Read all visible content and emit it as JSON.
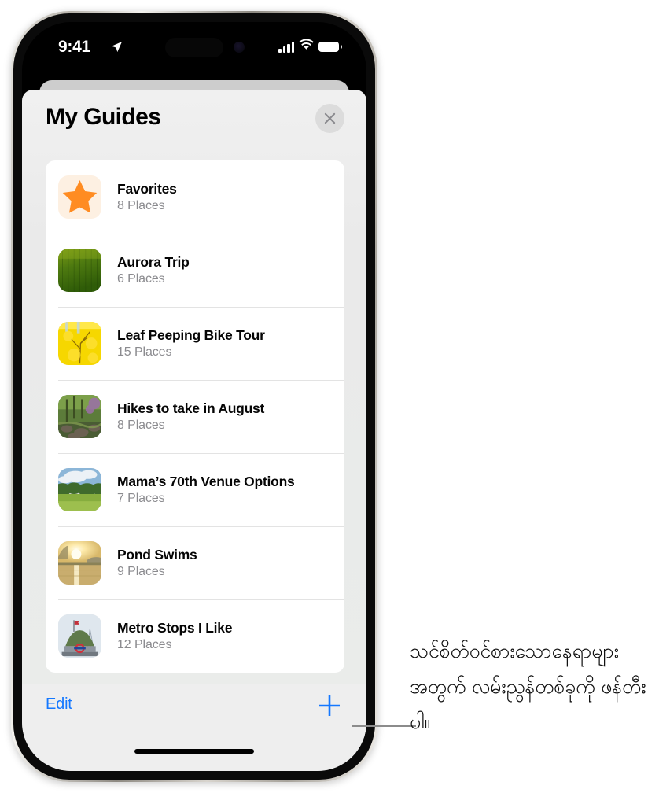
{
  "status_bar": {
    "time": "9:41",
    "location_icon": "location-arrow-icon",
    "signal_icon": "cellular-signal-icon",
    "wifi_icon": "wifi-icon",
    "battery_icon": "battery-full-icon"
  },
  "sheet": {
    "title": "My Guides",
    "close_icon": "close-x-icon"
  },
  "guides": [
    {
      "title": "Favorites",
      "places": "8 Places",
      "thumb": "star-icon"
    },
    {
      "title": "Aurora Trip",
      "places": "6 Places",
      "thumb": "green-field-photo"
    },
    {
      "title": "Leaf Peeping Bike Tour",
      "places": "15 Places",
      "thumb": "yellow-autumn-tree-photo"
    },
    {
      "title": "Hikes to take in August",
      "places": "8 Places",
      "thumb": "forest-trail-photo"
    },
    {
      "title": "Mama’s 70th Venue Options",
      "places": "7 Places",
      "thumb": "meadow-sky-photo"
    },
    {
      "title": "Pond Swims",
      "places": "9 Places",
      "thumb": "sunset-lake-photo"
    },
    {
      "title": "Metro Stops I Like",
      "places": "12 Places",
      "thumb": "metro-monument-photo"
    }
  ],
  "toolbar": {
    "edit_label": "Edit",
    "add_icon": "plus-icon"
  },
  "callout": {
    "text": "သင်စိတ်ဝင်စားသောနေရာများအတွက် လမ်းညွန်တစ်ခုကို ဖန်တီးပါ။"
  },
  "colors": {
    "accent_blue": "#1478ff",
    "star_orange": "#ff8c22",
    "star_bg": "#fdf0e2",
    "sheet_bg": "#eaeaea",
    "card_bg": "#ffffff",
    "subtitle_gray": "#8b8b8f"
  }
}
